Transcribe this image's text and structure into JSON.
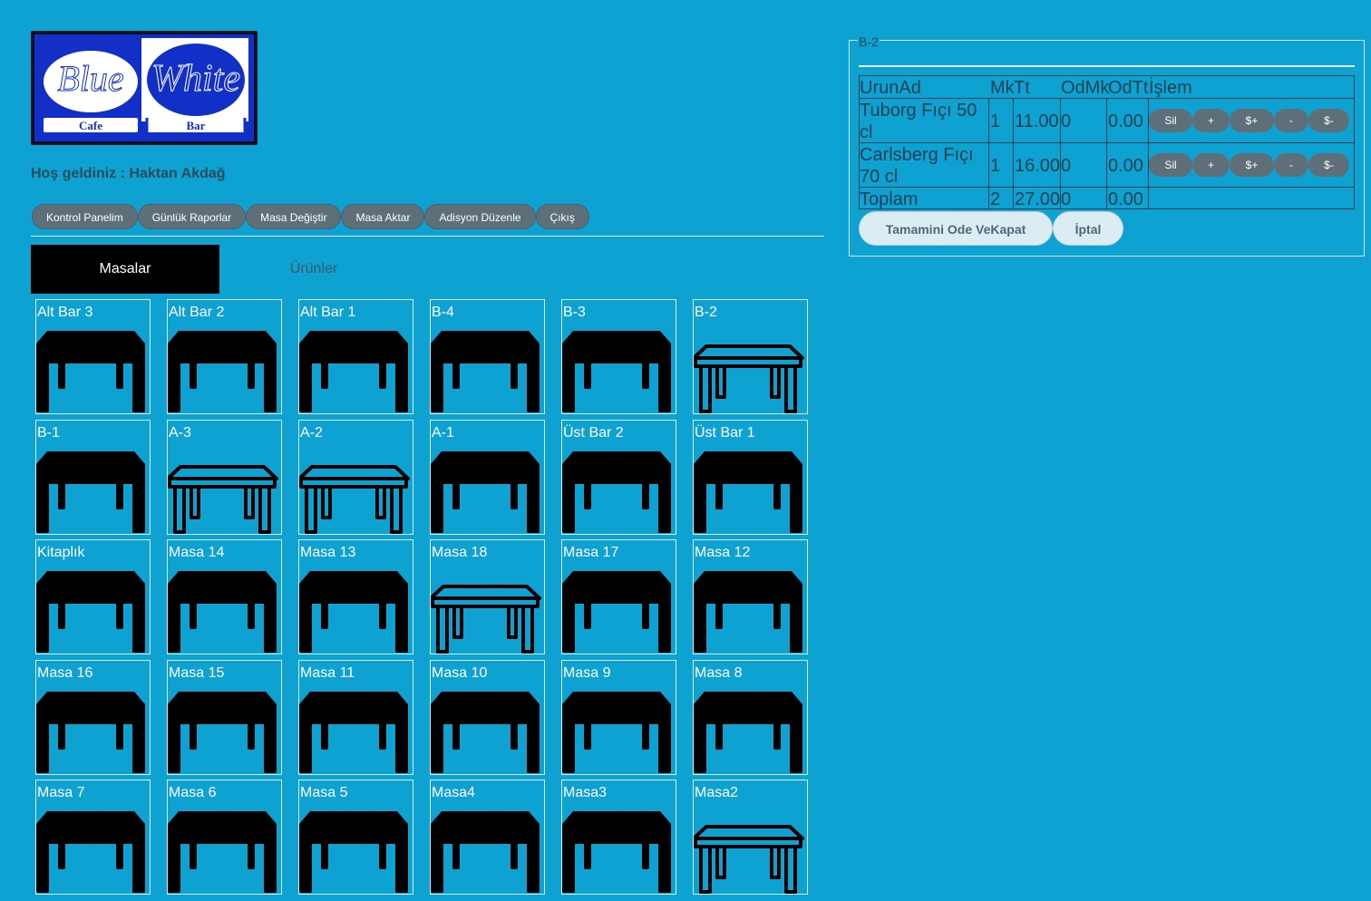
{
  "logo": {
    "left_text": "Blue",
    "right_text": "White",
    "left_sub": "Cafe",
    "right_sub": "Bar"
  },
  "welcome": "Hoş geldiniz : Haktan Akdağ",
  "nav": [
    "Kontrol Panelim",
    "Günlük Raporlar",
    "Masa Değiştir",
    "Masa Aktar",
    "Adisyon Düzenle",
    "Çıkış"
  ],
  "tabs": {
    "active": "Masalar",
    "inactive": "Ürünler"
  },
  "tables": [
    {
      "name": "Alt Bar 3",
      "status": "occupied"
    },
    {
      "name": "Alt Bar 2",
      "status": "occupied"
    },
    {
      "name": "Alt Bar 1",
      "status": "occupied"
    },
    {
      "name": "B-4",
      "status": "occupied"
    },
    {
      "name": "B-3",
      "status": "occupied"
    },
    {
      "name": "B-2",
      "status": "empty"
    },
    {
      "name": "B-1",
      "status": "occupied"
    },
    {
      "name": "A-3",
      "status": "empty"
    },
    {
      "name": "A-2",
      "status": "empty"
    },
    {
      "name": "A-1",
      "status": "occupied"
    },
    {
      "name": "Üst Bar 2",
      "status": "occupied"
    },
    {
      "name": "Üst Bar 1",
      "status": "occupied"
    },
    {
      "name": "Kitaplık",
      "status": "occupied"
    },
    {
      "name": "Masa 14",
      "status": "occupied"
    },
    {
      "name": "Masa 13",
      "status": "occupied"
    },
    {
      "name": "Masa 18",
      "status": "empty"
    },
    {
      "name": "Masa 17",
      "status": "occupied"
    },
    {
      "name": "Masa 12",
      "status": "occupied"
    },
    {
      "name": "Masa 16",
      "status": "occupied"
    },
    {
      "name": "Masa 15",
      "status": "occupied"
    },
    {
      "name": "Masa 11",
      "status": "occupied"
    },
    {
      "name": "Masa 10",
      "status": "occupied"
    },
    {
      "name": "Masa 9",
      "status": "occupied"
    },
    {
      "name": "Masa 8",
      "status": "occupied"
    },
    {
      "name": "Masa 7",
      "status": "occupied"
    },
    {
      "name": "Masa 6",
      "status": "occupied"
    },
    {
      "name": "Masa 5",
      "status": "occupied"
    },
    {
      "name": "Masa4",
      "status": "occupied"
    },
    {
      "name": "Masa3",
      "status": "occupied"
    },
    {
      "name": "Masa2",
      "status": "empty"
    }
  ],
  "order": {
    "legend": "B-2",
    "headers": {
      "urun": "UrunAd",
      "mk": "Mk",
      "tt": "Tt",
      "odmk": "OdMk",
      "odtt": "OdTt",
      "islem": "İşlem"
    },
    "rows": [
      {
        "urun_line1": "Tuborg Fıçı 50",
        "urun_line2": "cl",
        "mk": "1",
        "tt": "11.00",
        "odmk": "0",
        "odtt": "0.00"
      },
      {
        "urun_line1": "Carlsberg Fıçı",
        "urun_line2": "70 cl",
        "mk": "1",
        "tt": "16.00",
        "odmk": "0",
        "odtt": "0.00"
      }
    ],
    "total": {
      "label": "Toplam",
      "mk": "2",
      "tt": "27.00",
      "odmk": "0",
      "odtt": "0.00"
    },
    "row_actions": [
      "Sil",
      "+",
      "$+",
      "-",
      "$-"
    ],
    "buttons": {
      "pay": "Tamamini Ode VeKapat",
      "cancel": "İptal"
    }
  },
  "colors": {
    "background": "#0ea2d3",
    "occupied": "#000000",
    "empty_outline": "#000000",
    "button": "#5f6f7a"
  }
}
